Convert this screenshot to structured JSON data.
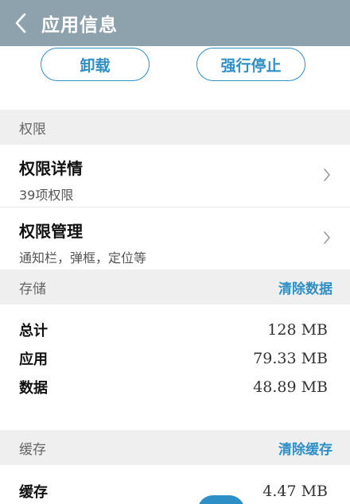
{
  "header": {
    "title": "应用信息",
    "back_icon": "chevron-left-icon"
  },
  "actions": {
    "uninstall_label": "卸载",
    "force_stop_label": "强行停止"
  },
  "permissions": {
    "section_title": "权限",
    "items": [
      {
        "title": "权限详情",
        "subtitle": "39项权限"
      },
      {
        "title": "权限管理",
        "subtitle": "通知栏，弹框，定位等"
      }
    ]
  },
  "storage": {
    "section_title": "存储",
    "action_label": "清除数据",
    "rows": [
      {
        "key": "总计",
        "value": "128 MB"
      },
      {
        "key": "应用",
        "value": "79.33 MB"
      },
      {
        "key": "数据",
        "value": "48.89 MB"
      }
    ]
  },
  "cache": {
    "section_title": "缓存",
    "action_label": "清除缓存",
    "rows": [
      {
        "key": "缓存",
        "value": "4.47 MB"
      }
    ]
  },
  "colors": {
    "accent": "#2e8fc6",
    "header_bg": "#8ea2ad",
    "section_bg": "#efefef"
  }
}
